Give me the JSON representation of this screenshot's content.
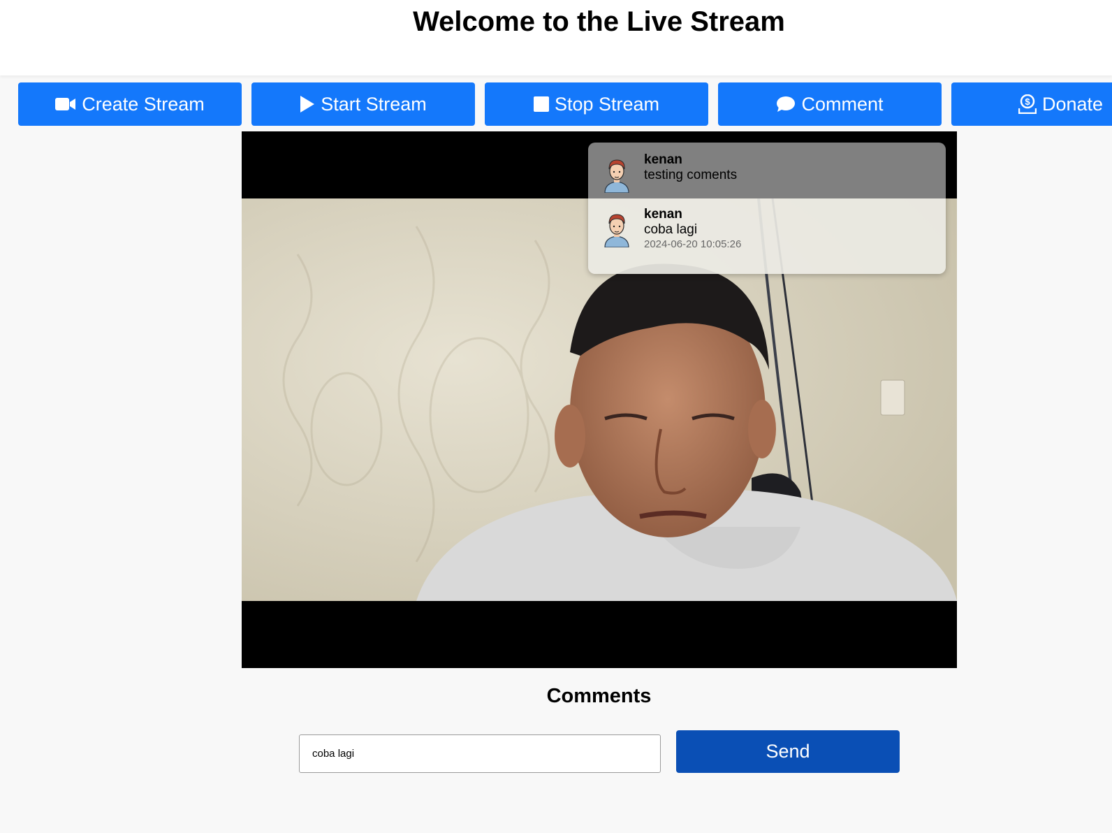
{
  "header": {
    "title": "Welcome to the Live Stream"
  },
  "toolbar": {
    "buttons": [
      {
        "label": "Create Stream",
        "icon": "video-camera-icon"
      },
      {
        "label": "Start Stream",
        "icon": "play-icon"
      },
      {
        "label": "Stop Stream",
        "icon": "stop-icon"
      },
      {
        "label": "Comment",
        "icon": "comment-icon"
      },
      {
        "label": "Donate",
        "icon": "donate-icon"
      }
    ],
    "accent_color": "#1478fb"
  },
  "video": {
    "overlay_comments": [
      {
        "user": "kenan",
        "message": "testing coments",
        "time": ""
      },
      {
        "user": "kenan",
        "message": "coba lagi",
        "time": "2024-06-20 10:05:26"
      }
    ]
  },
  "comments": {
    "title": "Comments",
    "input_value": "coba lagi",
    "send_label": "Send",
    "send_color": "#0a4fb5"
  }
}
